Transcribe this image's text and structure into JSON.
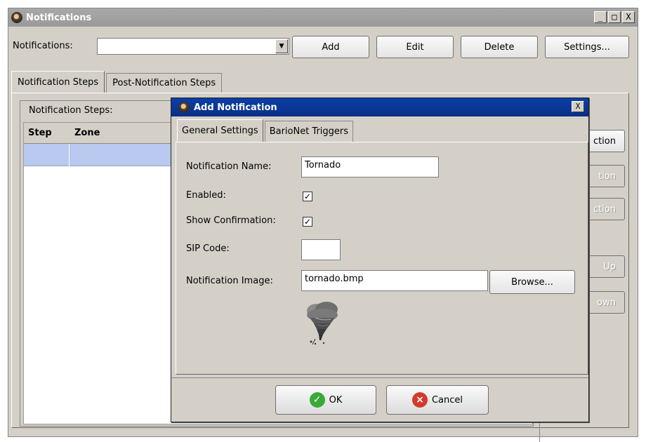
{
  "window": {
    "title": "Notifications",
    "minimize": "_",
    "maximize": "□",
    "close": "X"
  },
  "toolbar": {
    "notifications_label": "Notifications:",
    "combo_value": "",
    "add": "Add",
    "edit": "Edit",
    "delete": "Delete",
    "settings": "Settings..."
  },
  "tabs": [
    "Notification Steps",
    "Post-Notification Steps"
  ],
  "steps": {
    "group_title": "Notification Steps:",
    "columns": [
      "Step",
      "Zone"
    ]
  },
  "right_buttons": [
    {
      "label": "ction",
      "enabled": true
    },
    {
      "label": "tion",
      "enabled": false
    },
    {
      "label": "ction",
      "enabled": false
    },
    {
      "label": "Up",
      "enabled": false
    },
    {
      "label": "own",
      "enabled": false
    }
  ],
  "dialog": {
    "title": "Add Notification",
    "close": "X",
    "tabs": [
      "General Settings",
      "BarioNet Triggers"
    ],
    "fields": {
      "name_label": "Notification Name:",
      "name_value": "Tornado",
      "enabled_label": "Enabled:",
      "enabled_checked": true,
      "confirm_label": "Show Confirmation:",
      "confirm_checked": true,
      "sip_label": "SIP Code:",
      "sip_value": "",
      "image_label": "Notification Image:",
      "image_value": "tornado.bmp",
      "browse": "Browse..."
    },
    "ok": "OK",
    "cancel": "Cancel"
  },
  "check_glyph": "✓"
}
